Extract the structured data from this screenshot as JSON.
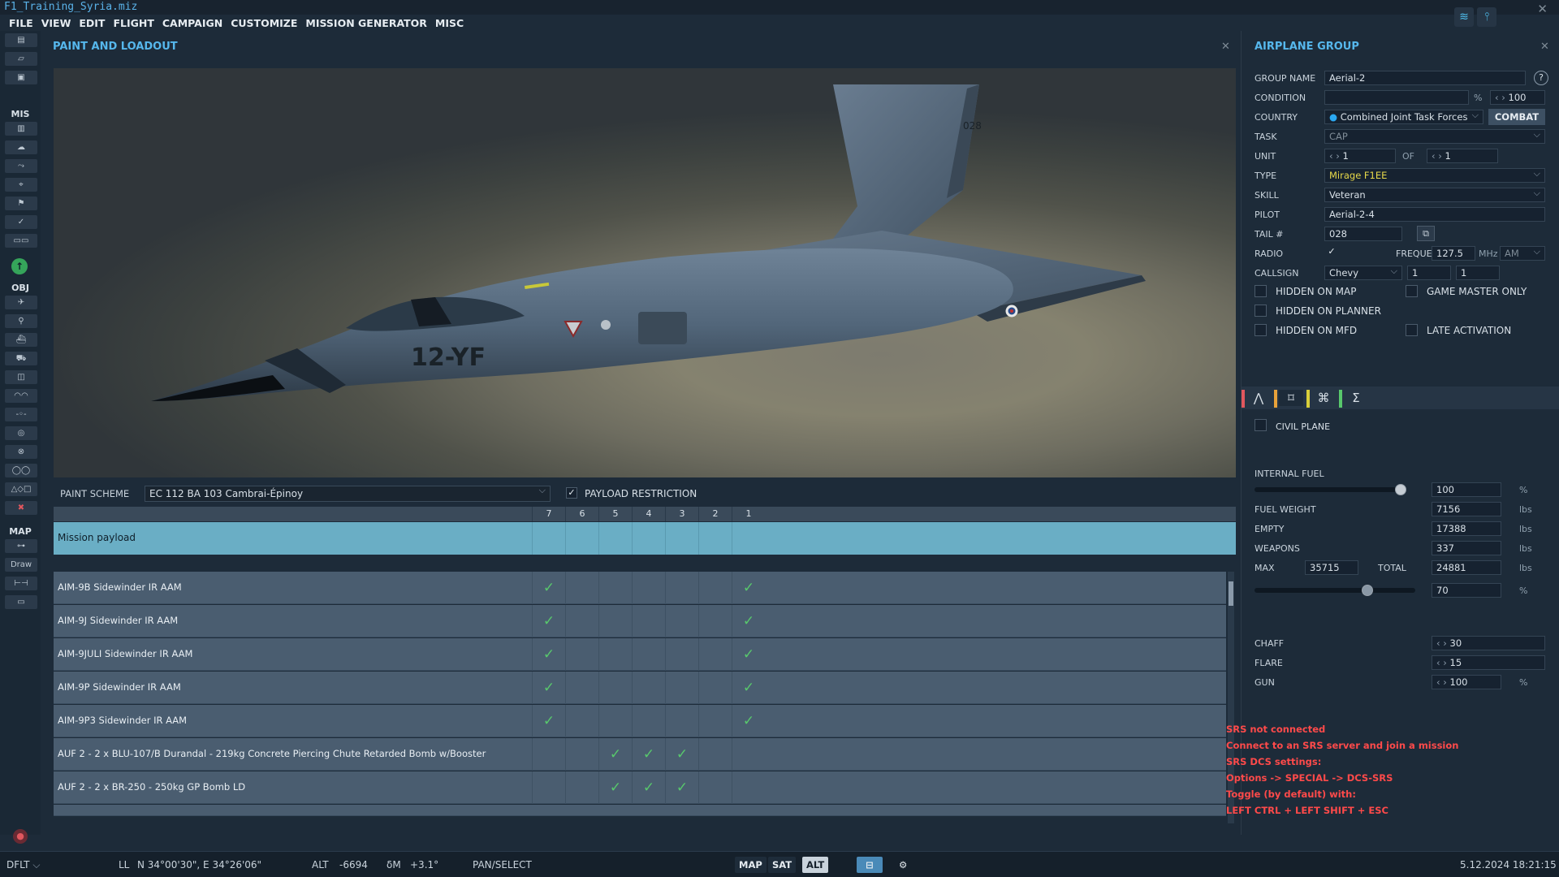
{
  "window": {
    "title": "F1_Training_Syria.miz"
  },
  "menu": [
    "FILE",
    "VIEW",
    "EDIT",
    "FLIGHT",
    "CAMPAIGN",
    "CUSTOMIZE",
    "MISSION GENERATOR",
    "MISC"
  ],
  "toolbar": {
    "sec_mis": "MIS",
    "sec_obj": "OBJ",
    "sec_map": "MAP",
    "draw": "Draw"
  },
  "paint": {
    "title": "PAINT AND LOADOUT",
    "aircraft_marking": "12-YF",
    "aircraft_tail": "028",
    "paint_scheme_label": "PAINT SCHEME",
    "paint_scheme_value": "EC 112 BA 103 Cambrai-Épinoy",
    "payload_restriction_label": "PAYLOAD RESTRICTION",
    "stations": [
      "7",
      "6",
      "5",
      "4",
      "3",
      "2",
      "1"
    ],
    "mission_payload": "Mission payload",
    "rows": [
      {
        "name": "AIM-9B Sidewinder IR AAM",
        "checks": [
          true,
          false,
          false,
          false,
          false,
          false,
          true
        ]
      },
      {
        "name": "AIM-9J Sidewinder IR AAM",
        "checks": [
          true,
          false,
          false,
          false,
          false,
          false,
          true
        ]
      },
      {
        "name": "AIM-9JULI Sidewinder IR AAM",
        "checks": [
          true,
          false,
          false,
          false,
          false,
          false,
          true
        ]
      },
      {
        "name": "AIM-9P Sidewinder IR AAM",
        "checks": [
          true,
          false,
          false,
          false,
          false,
          false,
          true
        ]
      },
      {
        "name": "AIM-9P3 Sidewinder IR AAM",
        "checks": [
          true,
          false,
          false,
          false,
          false,
          false,
          true
        ]
      },
      {
        "name": "AUF 2 - 2 x BLU-107/B Durandal - 219kg Concrete Piercing Chute Retarded Bomb w/Booster",
        "checks": [
          false,
          false,
          true,
          true,
          true,
          false,
          false
        ]
      },
      {
        "name": "AUF 2 - 2 x BR-250 - 250kg GP Bomb LD",
        "checks": [
          false,
          false,
          true,
          true,
          true,
          false,
          false
        ]
      }
    ]
  },
  "group": {
    "title": "AIRPLANE GROUP",
    "help": "?",
    "labels": {
      "group_name": "GROUP NAME",
      "condition": "CONDITION",
      "country": "COUNTRY",
      "task": "TASK",
      "unit": "UNIT",
      "of": "OF",
      "type": "TYPE",
      "skill": "SKILL",
      "pilot": "PILOT",
      "tail": "TAIL #",
      "radio": "RADIO",
      "frequency": "FREQUENCY",
      "callsign": "CALLSIGN"
    },
    "values": {
      "group_name": "Aerial-2",
      "condition_pct": "%",
      "condition_max": "100",
      "country": "Combined Joint Task Forces",
      "combat": "COMBAT",
      "task": "CAP",
      "unit": "1",
      "unit_of": "1",
      "type": "Mirage F1EE",
      "skill": "Veteran",
      "pilot": "Aerial-2-4",
      "tail": "028",
      "frequency": "127.5",
      "mhz": "MHz",
      "modulation": "AM",
      "callsign": "Chevy",
      "callsign_n1": "1",
      "callsign_n2": "1"
    },
    "flags": {
      "hidden_map": "HIDDEN ON MAP",
      "game_master": "GAME MASTER ONLY",
      "hidden_planner": "HIDDEN ON PLANNER",
      "hidden_mfd": "HIDDEN ON MFD",
      "late_activation": "LATE ACTIVATION"
    },
    "civil_plane": "CIVIL PLANE",
    "fuel": {
      "internal_fuel": "INTERNAL FUEL",
      "internal_fuel_value": "100",
      "internal_fuel_level": 1.0,
      "pct": "%",
      "fuel_weight": "FUEL WEIGHT",
      "fuel_weight_value": "7156",
      "empty": "EMPTY",
      "empty_value": "17388",
      "weapons": "WEAPONS",
      "weapons_value": "337",
      "max": "MAX",
      "max_value": "35715",
      "total": "TOTAL",
      "total_value": "24881",
      "lbs": "lbs",
      "load_pct": "70",
      "load_level": 0.7
    },
    "counter": {
      "chaff": "CHAFF",
      "chaff_value": "30",
      "flare": "FLARE",
      "flare_value": "15",
      "gun": "GUN",
      "gun_value": "100",
      "pct": "%"
    },
    "tab_colors": [
      "#e0575e",
      "#e8a23a",
      "#d9cf3a",
      "#58c86c"
    ]
  },
  "srs": [
    "SRS not connected",
    "Connect to an SRS server and join a mission",
    "SRS DCS settings:",
    "Options -> SPECIAL -> DCS-SRS",
    "Toggle (by default) with:",
    "LEFT CTRL + LEFT SHIFT + ESC"
  ],
  "status": {
    "profile": "DFLT",
    "ll_label": "LL",
    "coords": "N 34°00'30\", E 34°26'06\"",
    "alt_label": "ALT",
    "alt_value": "-6694",
    "dm_label": "δM",
    "dm_value": "+3.1°",
    "mode": "PAN/SELECT",
    "btn_map": "MAP",
    "btn_sat": "SAT",
    "btn_alt": "ALT",
    "datetime": "5.12.2024 18:21:15"
  }
}
